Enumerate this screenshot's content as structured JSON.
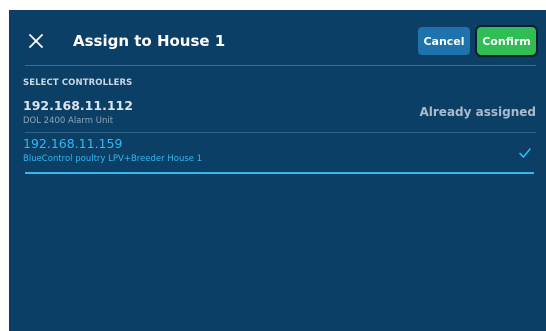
{
  "header": {
    "title": "Assign to House 1",
    "cancel_label": "Cancel",
    "confirm_label": "Confirm"
  },
  "section": {
    "label": "SELECT CONTROLLERS"
  },
  "controllers": [
    {
      "ip": "192.168.11.112",
      "description": "DOL 2400 Alarm Unit",
      "status": "Already assigned",
      "selected": false
    },
    {
      "ip": "192.168.11.159",
      "description": "BlueControl poultry LPV+Breeder House 1",
      "status": "",
      "selected": true
    }
  ],
  "colors": {
    "background": "#0c3f66",
    "accent": "#32b7ef",
    "confirm": "#2fbd54",
    "cancel": "#1f73ad"
  },
  "icons": {
    "close": "close-icon",
    "selected": "check-icon"
  }
}
